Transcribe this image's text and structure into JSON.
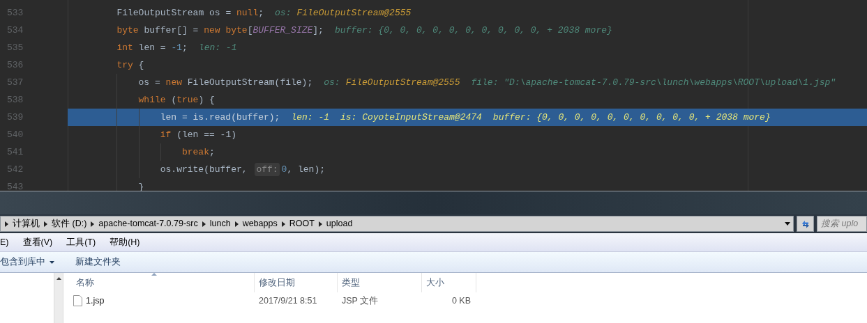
{
  "editor": {
    "lines": [
      {
        "number": "533",
        "selected": false,
        "tokens": [
          {
            "kind": "plain",
            "text": "        FileOutputStream os = "
          },
          {
            "kind": "keyword",
            "text": "null"
          },
          {
            "kind": "plain",
            "text": ";"
          },
          {
            "kind": "hint_name",
            "text": "os:"
          },
          {
            "kind": "hint_value",
            "text": "FileOutputStream@2555"
          }
        ]
      },
      {
        "number": "534",
        "selected": false,
        "tokens": [
          {
            "kind": "keyword",
            "text": "        byte"
          },
          {
            "kind": "plain",
            "text": " buffer[] = "
          },
          {
            "kind": "keyword",
            "text": "new"
          },
          {
            "kind": "keyword",
            "text": " byte"
          },
          {
            "kind": "plain",
            "text": "["
          },
          {
            "kind": "constant",
            "text": "BUFFER_SIZE"
          },
          {
            "kind": "plain",
            "text": "];"
          },
          {
            "kind": "hint_name",
            "text": "buffer:"
          },
          {
            "kind": "hint_name",
            "text": " {0, 0, 0, 0, 0, 0, 0, 0, 0, 0, + 2038 more}"
          }
        ]
      },
      {
        "number": "535",
        "selected": false,
        "tokens": [
          {
            "kind": "keyword",
            "text": "        int"
          },
          {
            "kind": "plain",
            "text": " len = "
          },
          {
            "kind": "number",
            "text": "-1"
          },
          {
            "kind": "plain",
            "text": ";"
          },
          {
            "kind": "hint_name",
            "text": "len: -1"
          }
        ]
      },
      {
        "number": "536",
        "selected": false,
        "tokens": [
          {
            "kind": "keyword",
            "text": "        try"
          },
          {
            "kind": "plain",
            "text": " {"
          }
        ]
      },
      {
        "number": "537",
        "selected": false,
        "tokens": [
          {
            "kind": "plain",
            "text": "            os = "
          },
          {
            "kind": "keyword",
            "text": "new"
          },
          {
            "kind": "plain",
            "text": " FileOutputStream(file);"
          },
          {
            "kind": "hint_name",
            "text": "os:"
          },
          {
            "kind": "hint_value",
            "text": "FileOutputStream@2555"
          },
          {
            "kind": "hint_name",
            "text": "file:"
          },
          {
            "kind": "hint_name",
            "text": " \"D:\\apache-tomcat-7.0.79-src\\lunch\\webapps\\ROOT\\upload\\1.jsp\""
          }
        ]
      },
      {
        "number": "538",
        "selected": false,
        "tokens": [
          {
            "kind": "keyword",
            "text": "            while"
          },
          {
            "kind": "plain",
            "text": " ("
          },
          {
            "kind": "keyword",
            "text": "true"
          },
          {
            "kind": "plain",
            "text": ") {"
          }
        ]
      },
      {
        "number": "539",
        "selected": true,
        "tokens": [
          {
            "kind": "plain",
            "text": "                len = is.read(buffer);"
          },
          {
            "kind": "hint_name",
            "text": "len: -1"
          },
          {
            "kind": "hint_name",
            "text": "is: CoyoteInputStream@2474"
          },
          {
            "kind": "hint_name",
            "text": "buffer: {0, 0, 0, 0, 0, 0, 0, 0, 0, 0, + 2038 more}"
          }
        ]
      },
      {
        "number": "540",
        "selected": false,
        "tokens": [
          {
            "kind": "keyword",
            "text": "                if"
          },
          {
            "kind": "plain",
            "text": " (len == -1)"
          }
        ]
      },
      {
        "number": "541",
        "selected": false,
        "tokens": [
          {
            "kind": "keyword",
            "text": "                    break"
          },
          {
            "kind": "plain",
            "text": ";"
          }
        ]
      },
      {
        "number": "542",
        "selected": false,
        "tokens": [
          {
            "kind": "plain",
            "text": "                os.write(buffer, "
          },
          {
            "kind": "param_hint",
            "text": "off:"
          },
          {
            "kind": "number",
            "text": "0"
          },
          {
            "kind": "plain",
            "text": ", len);"
          }
        ]
      },
      {
        "number": "543",
        "selected": false,
        "tokens": [
          {
            "kind": "plain",
            "text": "            }"
          }
        ]
      }
    ]
  },
  "explorer": {
    "breadcrumbs": [
      "计算机",
      "软件 (D:)",
      "apache-tomcat-7.0.79-src",
      "lunch",
      "webapps",
      "ROOT",
      "upload"
    ],
    "search": {
      "placeholder": "搜索 uplo"
    },
    "menu": [
      "E)",
      "查看(V)",
      "工具(T)",
      "帮助(H)"
    ],
    "toolbar": [
      {
        "label": "包含到库中",
        "dropdown": true
      },
      {
        "label": "新建文件夹",
        "dropdown": false
      }
    ],
    "columns": [
      "名称",
      "修改日期",
      "类型",
      "大小"
    ],
    "files": [
      {
        "name": "1.jsp",
        "modified": "2017/9/21 8:51",
        "type": "JSP 文件",
        "size": "0 KB"
      }
    ]
  }
}
